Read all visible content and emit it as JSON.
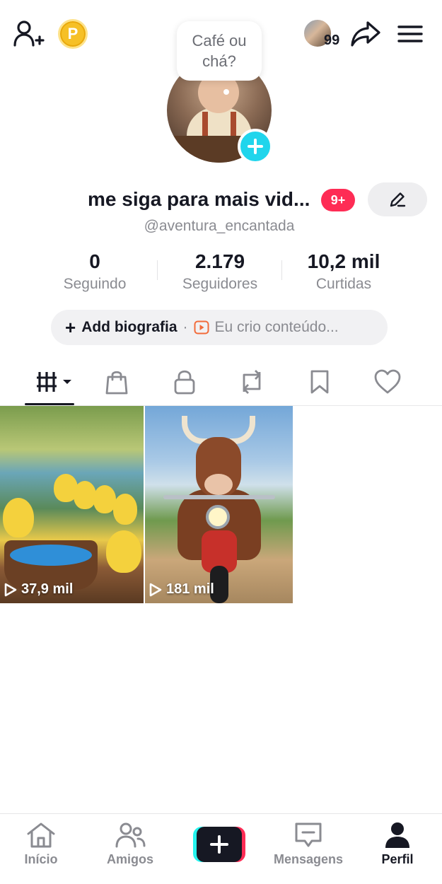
{
  "top_bar": {
    "coin_letter": "P",
    "friends_count": "99"
  },
  "profile": {
    "bubble_text": "Café ou chá?",
    "display_name": "me siga para mais vid...",
    "notification_badge": "9+",
    "username": "@aventura_encantada"
  },
  "stats": [
    {
      "value": "0",
      "label": "Seguindo"
    },
    {
      "value": "2.179",
      "label": "Seguidores"
    },
    {
      "value": "10,2 mil",
      "label": "Curtidas"
    }
  ],
  "bio": {
    "add_label": "Add biografia",
    "separator": "·",
    "creator_label": "Eu crio conteúdo..."
  },
  "tabs": [
    "videos-grid-icon",
    "shop-bag-icon",
    "lock-icon",
    "repost-icon",
    "bookmark-icon",
    "heart-icon"
  ],
  "videos": [
    {
      "views": "37,9 mil",
      "subject": "ducklings by a pond"
    },
    {
      "views": "181 mil",
      "subject": "bull riding a motorcycle"
    }
  ],
  "bottom_nav": {
    "home": "Início",
    "friends": "Amigos",
    "messages": "Mensagens",
    "profile": "Perfil"
  },
  "colors": {
    "accent_cyan": "#20d5ec",
    "accent_pink": "#fe2c55",
    "coin_gold": "#f6c026",
    "text_primary": "#161823",
    "text_secondary": "#8a8b91"
  }
}
